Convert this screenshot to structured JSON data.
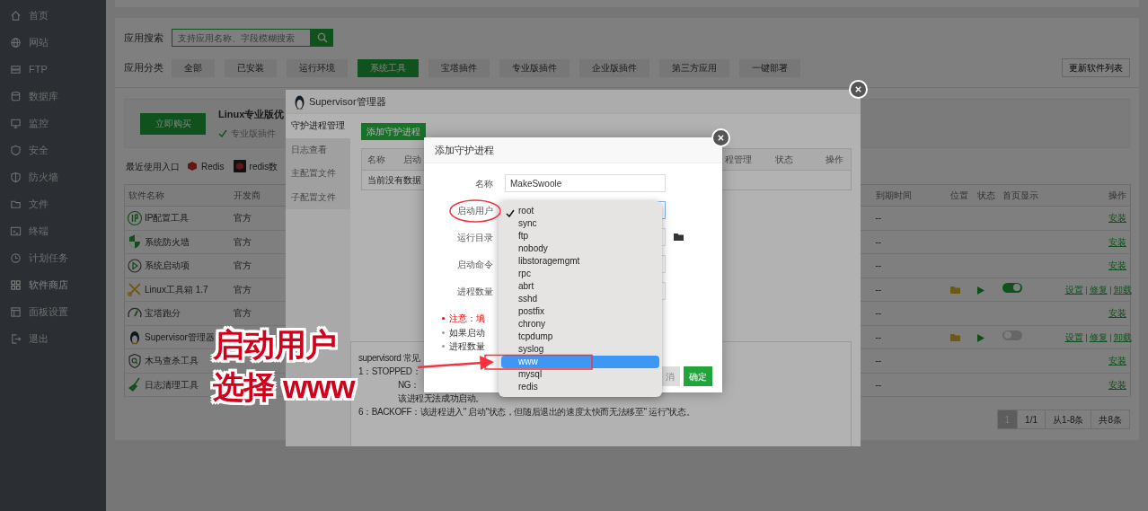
{
  "sidebar": {
    "items": [
      {
        "label": "首页",
        "selected": false
      },
      {
        "label": "网站",
        "selected": false
      },
      {
        "label": "FTP",
        "selected": false
      },
      {
        "label": "数据库",
        "selected": false
      },
      {
        "label": "监控",
        "selected": false
      },
      {
        "label": "安全",
        "selected": false
      },
      {
        "label": "防火墙",
        "selected": false
      },
      {
        "label": "文件",
        "selected": false
      },
      {
        "label": "终端",
        "selected": false
      },
      {
        "label": "计划任务",
        "selected": false
      },
      {
        "label": "软件商店",
        "selected": true
      },
      {
        "label": "面板设置",
        "selected": false
      },
      {
        "label": "退出",
        "selected": false
      }
    ]
  },
  "search": {
    "label": "应用搜索",
    "placeholder": "支持应用名称、字段模糊搜索"
  },
  "categories": {
    "label": "应用分类",
    "items": [
      {
        "label": "全部",
        "selected": false
      },
      {
        "label": "已安装",
        "selected": false
      },
      {
        "label": "运行环境",
        "selected": false
      },
      {
        "label": "系统工具",
        "selected": true
      },
      {
        "label": "宝塔插件",
        "selected": false
      },
      {
        "label": "专业版插件",
        "selected": false
      },
      {
        "label": "企业版插件",
        "selected": false
      },
      {
        "label": "第三方应用",
        "selected": false
      },
      {
        "label": "一键部署",
        "selected": false
      }
    ],
    "refresh_button": "更新软件列表"
  },
  "promo": {
    "buy_button": "立即购买",
    "title": "Linux专业版优",
    "feature": "专业版插件"
  },
  "recent": {
    "label": "最近使用入口",
    "items": [
      "Redis",
      "redis数"
    ]
  },
  "table": {
    "columns": [
      "软件名称",
      "开发商",
      "到期时间",
      "位置",
      "状态",
      "首页显示",
      "操作"
    ],
    "rows": [
      {
        "name": "IP配置工具",
        "developer": "官方",
        "expiry": "--",
        "installed": false,
        "actions": [
          "安装"
        ]
      },
      {
        "name": "系统防火墙",
        "developer": "官方",
        "expiry": "--",
        "installed": false,
        "actions": [
          "安装"
        ]
      },
      {
        "name": "系统启动项",
        "developer": "官方",
        "expiry": "--",
        "installed": false,
        "actions": [
          "安装"
        ]
      },
      {
        "name": "Linux工具箱 1.7",
        "developer": "官方",
        "expiry": "--",
        "installed": true,
        "homepage": true,
        "actions": [
          "设置",
          "修复",
          "卸载"
        ]
      },
      {
        "name": "宝塔跑分",
        "developer": "官方",
        "expiry": "--",
        "installed": false,
        "actions": [
          "安装"
        ]
      },
      {
        "name": "Supervisor管理器",
        "expiry": "--",
        "installed": true,
        "homepage": false,
        "actions": [
          "设置",
          "修复",
          "卸载"
        ]
      },
      {
        "name": "木马查杀工具",
        "expiry": "--",
        "installed": false,
        "actions": [
          "安装"
        ]
      },
      {
        "name": "日志清理工具",
        "expiry": "--",
        "installed": false,
        "actions": [
          "安装"
        ]
      }
    ]
  },
  "pagination": {
    "pages": [
      {
        "label": "1",
        "selected": true
      }
    ],
    "info": [
      "1/1",
      "从1-8条",
      "共8条"
    ]
  },
  "supervisor": {
    "title": "Supervisor管理器",
    "menu": [
      {
        "label": "守护进程管理",
        "selected": true
      },
      {
        "label": "日志查看",
        "selected": false
      },
      {
        "label": "主配置文件",
        "selected": false
      },
      {
        "label": "子配置文件",
        "selected": false
      }
    ],
    "add_button": "添加守护进程",
    "columns": [
      "名称",
      "启动",
      "程管理",
      "状态",
      "操作"
    ],
    "empty": "当前没有数据",
    "notes": [
      {
        "text": "supervisord 常见",
        "cut_left": false
      },
      {
        "text": "1：STOPPED：",
        "cut_left": false
      },
      {
        "text": "NG：",
        "cut_left": true
      },
      {
        "text": "该进程无法成功启动。",
        "cut_left": true
      },
      {
        "text": "6：BACKOFF：该进程进入\" 启动\"状态，但随后退出的速度太快而无法移至\" 运行\"状态。",
        "cut_left": false
      }
    ]
  },
  "add_dialog": {
    "title": "添加守护进程",
    "fields": [
      {
        "label": "名称",
        "kind": "text",
        "value": "MakeSwoole"
      },
      {
        "label": "启动用户",
        "kind": "select"
      },
      {
        "label": "运行目录",
        "kind": "dir"
      },
      {
        "label": "启动命令",
        "kind": "text"
      },
      {
        "label": "进程数量",
        "kind": "text"
      }
    ],
    "notes": [
      {
        "text": "注意：填",
        "kind": "warning"
      },
      {
        "text": "如果启动",
        "kind": "info"
      },
      {
        "text": "进程数量",
        "kind": "info"
      }
    ],
    "buttons": [
      {
        "label": "消",
        "kind": "cancel"
      },
      {
        "label": "确定",
        "kind": "primary"
      }
    ]
  },
  "dropdown": {
    "options": [
      {
        "label": "root",
        "checked": true,
        "selected": false
      },
      {
        "label": "sync",
        "checked": false,
        "selected": false
      },
      {
        "label": "ftp",
        "checked": false,
        "selected": false
      },
      {
        "label": "nobody",
        "checked": false,
        "selected": false
      },
      {
        "label": "libstoragemgmt",
        "checked": false,
        "selected": false
      },
      {
        "label": "rpc",
        "checked": false,
        "selected": false
      },
      {
        "label": "abrt",
        "checked": false,
        "selected": false
      },
      {
        "label": "sshd",
        "checked": false,
        "selected": false
      },
      {
        "label": "postfix",
        "checked": false,
        "selected": false
      },
      {
        "label": "chrony",
        "checked": false,
        "selected": false
      },
      {
        "label": "tcpdump",
        "checked": false,
        "selected": false
      },
      {
        "label": "syslog",
        "checked": false,
        "selected": false
      },
      {
        "label": "www",
        "checked": false,
        "selected": true
      },
      {
        "label": "mysql",
        "checked": false,
        "selected": false
      },
      {
        "label": "redis",
        "checked": false,
        "selected": false
      }
    ]
  },
  "annotation": {
    "lines": [
      "启动用户",
      "选择 www"
    ]
  }
}
